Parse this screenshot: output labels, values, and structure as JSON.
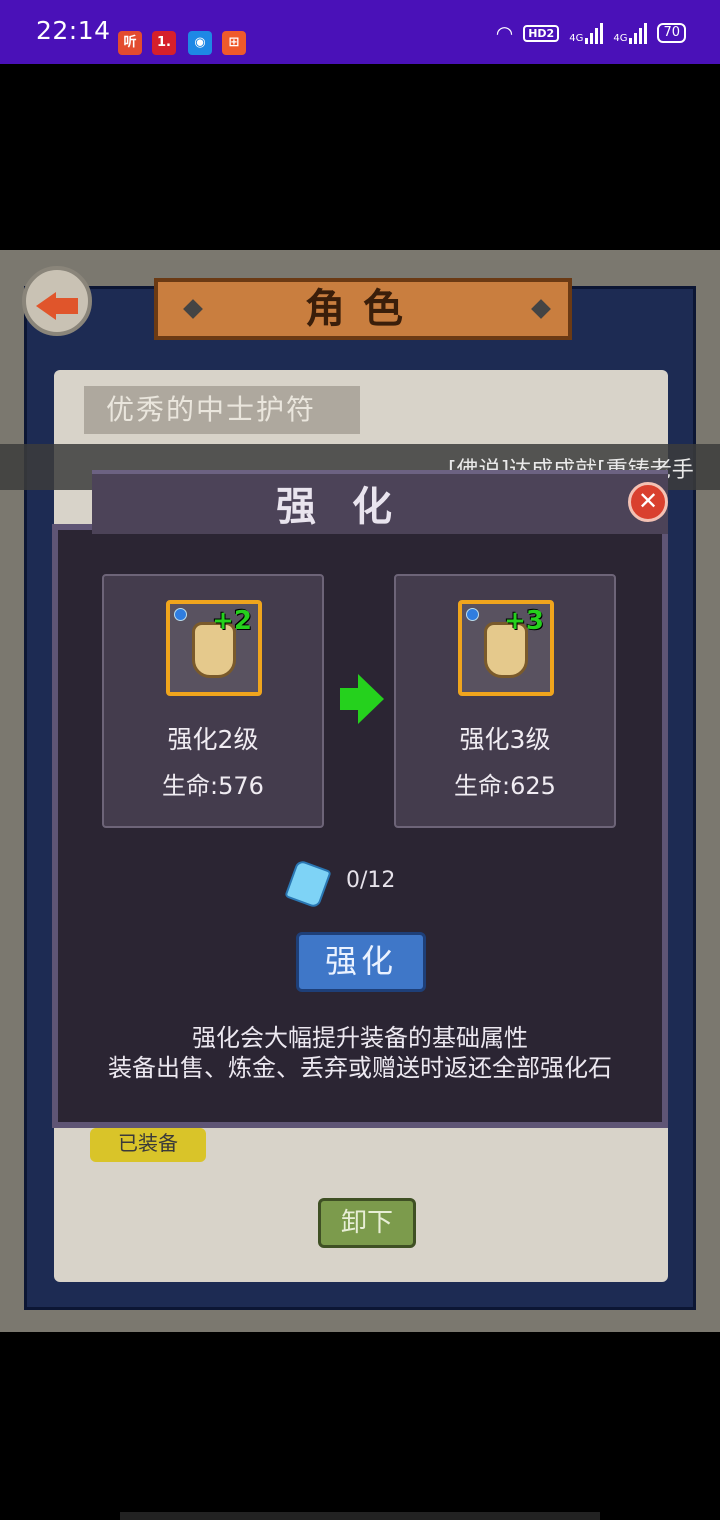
{
  "status_bar": {
    "time": "22:14",
    "app_icons": [
      {
        "name": "listen-app-icon",
        "glyph": "听",
        "color": "#e34b2f"
      },
      {
        "name": "one-app-icon",
        "glyph": "1.",
        "color": "#d6202b"
      },
      {
        "name": "circle-app-icon",
        "glyph": "◉",
        "color": "#1e88e5"
      },
      {
        "name": "grid-app-icon",
        "glyph": "⊞",
        "color": "#ef5a2b"
      }
    ],
    "hd_label": "HD2",
    "signal1_label": "4G",
    "signal2_label": "4G",
    "battery": "70"
  },
  "background_screen": {
    "title": "角色",
    "item_name": "优秀的中士护符",
    "equipped_tag": "已装备",
    "unequip_label": "卸下"
  },
  "ticker": {
    "text": "[佛说]达成成就[重铸老手"
  },
  "modal": {
    "title": "强化",
    "current": {
      "plus": "+2",
      "level_label": "强化2级",
      "stat": "生命:576"
    },
    "next": {
      "plus": "+3",
      "level_label": "强化3级",
      "stat": "生命:625"
    },
    "stone_count": "0/12",
    "enhance_label": "强化",
    "hint_line1": "强化会大幅提升装备的基础属性",
    "hint_line2": "装备出售、炼金、丢弃或赠送时返还全部强化石"
  }
}
